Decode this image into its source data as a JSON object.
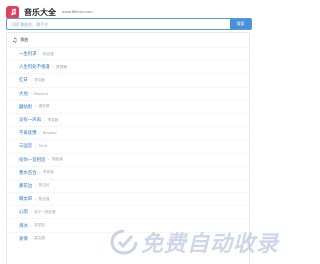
{
  "header": {
    "title": "音乐大全",
    "url": "www.88hmv.com"
  },
  "search": {
    "placeholder": "可搜 歌曲名、歌手名",
    "button_label": "搜索"
  },
  "list": {
    "title": "歌曲",
    "items": [
      {
        "name": "一生何求",
        "artist": "陈百强"
      },
      {
        "name": "人生何处不相逢",
        "artist": "陈慧娴"
      },
      {
        "name": "红日",
        "artist": "李克勤"
      },
      {
        "name": "大地",
        "artist": "Beyond"
      },
      {
        "name": "囍帖街",
        "artist": "谢安琪"
      },
      {
        "name": "没有一声再",
        "artist": "李克勤"
      },
      {
        "name": "不再犹豫",
        "artist": "Beyond"
      },
      {
        "name": "三国恋",
        "artist": "Tank"
      },
      {
        "name": "投你一首相思",
        "artist": "张韶涵"
      },
      {
        "name": "曹水百合",
        "artist": "李克勤"
      },
      {
        "name": "藤花边",
        "artist": "陈洁仪"
      },
      {
        "name": "卿女郎",
        "artist": "陈百强"
      },
      {
        "name": "心雨",
        "artist": "毛宁 / 杨钰莹"
      },
      {
        "name": "滑冰",
        "artist": "张学友"
      },
      {
        "name": "爱情",
        "artist": "莫文蔚"
      }
    ]
  },
  "watermark": {
    "text": "免费自动收录"
  },
  "colors": {
    "brand": "#e0405a",
    "accent": "#4a90d9",
    "link": "#2a76c6"
  }
}
